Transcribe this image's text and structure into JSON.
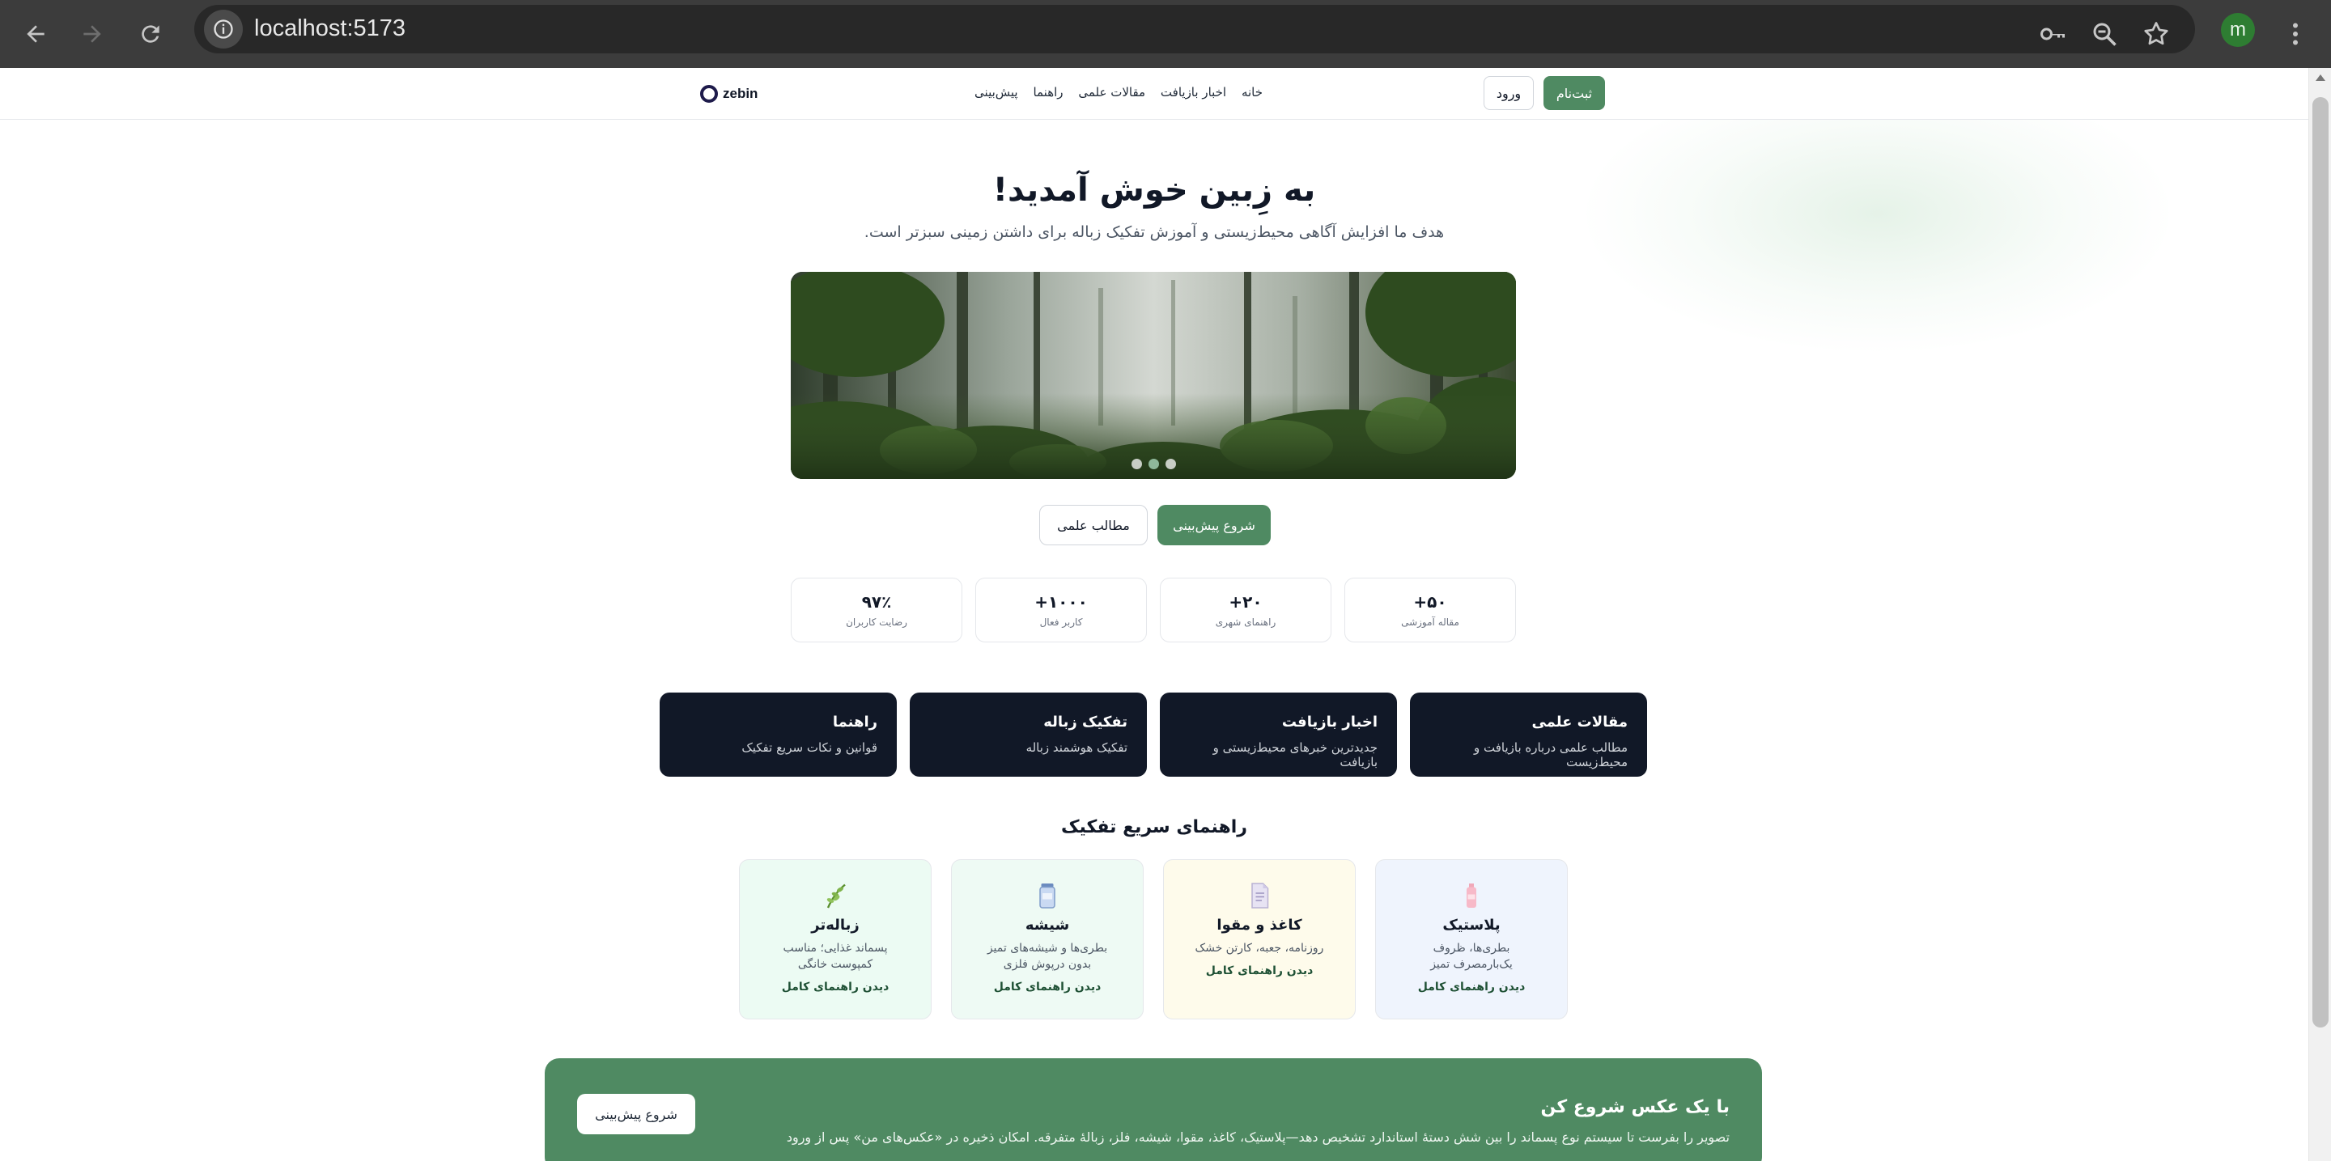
{
  "browser": {
    "url": "localhost:5173",
    "profile_initial": "m"
  },
  "header": {
    "logo_text": "zebin",
    "nav": [
      "خانه",
      "اخبار بازیافت",
      "مقالات علمی",
      "راهنما",
      "پیش‌بینی"
    ],
    "signup_label": "ثبت‌نام",
    "login_label": "ورود"
  },
  "hero": {
    "title": "به زِبین خوش آمدید!",
    "subtitle": "هدف ما افزایش آگاهی محیط‌زیستی و آموزش تفکیک زباله برای داشتن زمینی سبزتر است.",
    "carousel_slides": 3,
    "carousel_active": 2,
    "start_label": "شروع پیش‌بینی",
    "articles_label": "مطالب علمی"
  },
  "stats": [
    {
      "value": "۵۰+",
      "label": "مقاله آموزشی"
    },
    {
      "value": "۲۰+",
      "label": "راهنمای شهری"
    },
    {
      "value": "۱۰۰۰+",
      "label": "کاربر فعال"
    },
    {
      "value": "۹۷٪",
      "label": "رضایت کاربران"
    }
  ],
  "features": [
    {
      "title": "مقالات علمی",
      "desc": "مطالب علمی درباره بازیافت و محیط‌زیست"
    },
    {
      "title": "اخبار بازیافت",
      "desc": "جدیدترین خبرهای محیط‌زیستی و بازیافت"
    },
    {
      "title": "تفکیک زباله",
      "desc": "تفکیک هوشمند زباله"
    },
    {
      "title": "راهنما",
      "desc": "قوانین و نکات سریع تفکیک"
    }
  ],
  "guide": {
    "title": "راهنمای سریع تفکیک",
    "cards": [
      {
        "name": "پلاستیک",
        "desc": "بطری‌ها، ظروف یک‌بارمصرف تمیز",
        "link": "دیدن راهنمای کامل",
        "bg": "#eff4fd",
        "icon": "plastic-bottle-icon"
      },
      {
        "name": "کاغذ و مقوا",
        "desc": "روزنامه، جعبه، کارتن خشک",
        "link": "دیدن راهنمای کامل",
        "bg": "#fefbeb",
        "icon": "paper-icon"
      },
      {
        "name": "شیشه",
        "desc": "بطری‌ها و شیشه‌های تمیز بدون درپوش فلزی",
        "link": "دیدن راهنمای کامل",
        "bg": "#eefaf4",
        "icon": "glass-jar-icon"
      },
      {
        "name": "زباله‌تر",
        "desc": "پسماند غذایی؛ مناسب کمپوست خانگی",
        "link": "دیدن راهنمای کامل",
        "bg": "#ecfbf3",
        "icon": "herb-icon"
      }
    ]
  },
  "banner": {
    "title": "با یک عکس شروع کن",
    "desc": "تصویر را بفرست تا سیستم نوع پسماند را بین شش دستهٔ استاندارد تشخیص دهد—پلاستیک، کاغذ، مقوا، شیشه، فلز، زبالهٔ متفرقه. امکان ذخیره در «عکس‌های من» پس از ورود",
    "button_label": "شروع پیش‌بینی"
  }
}
